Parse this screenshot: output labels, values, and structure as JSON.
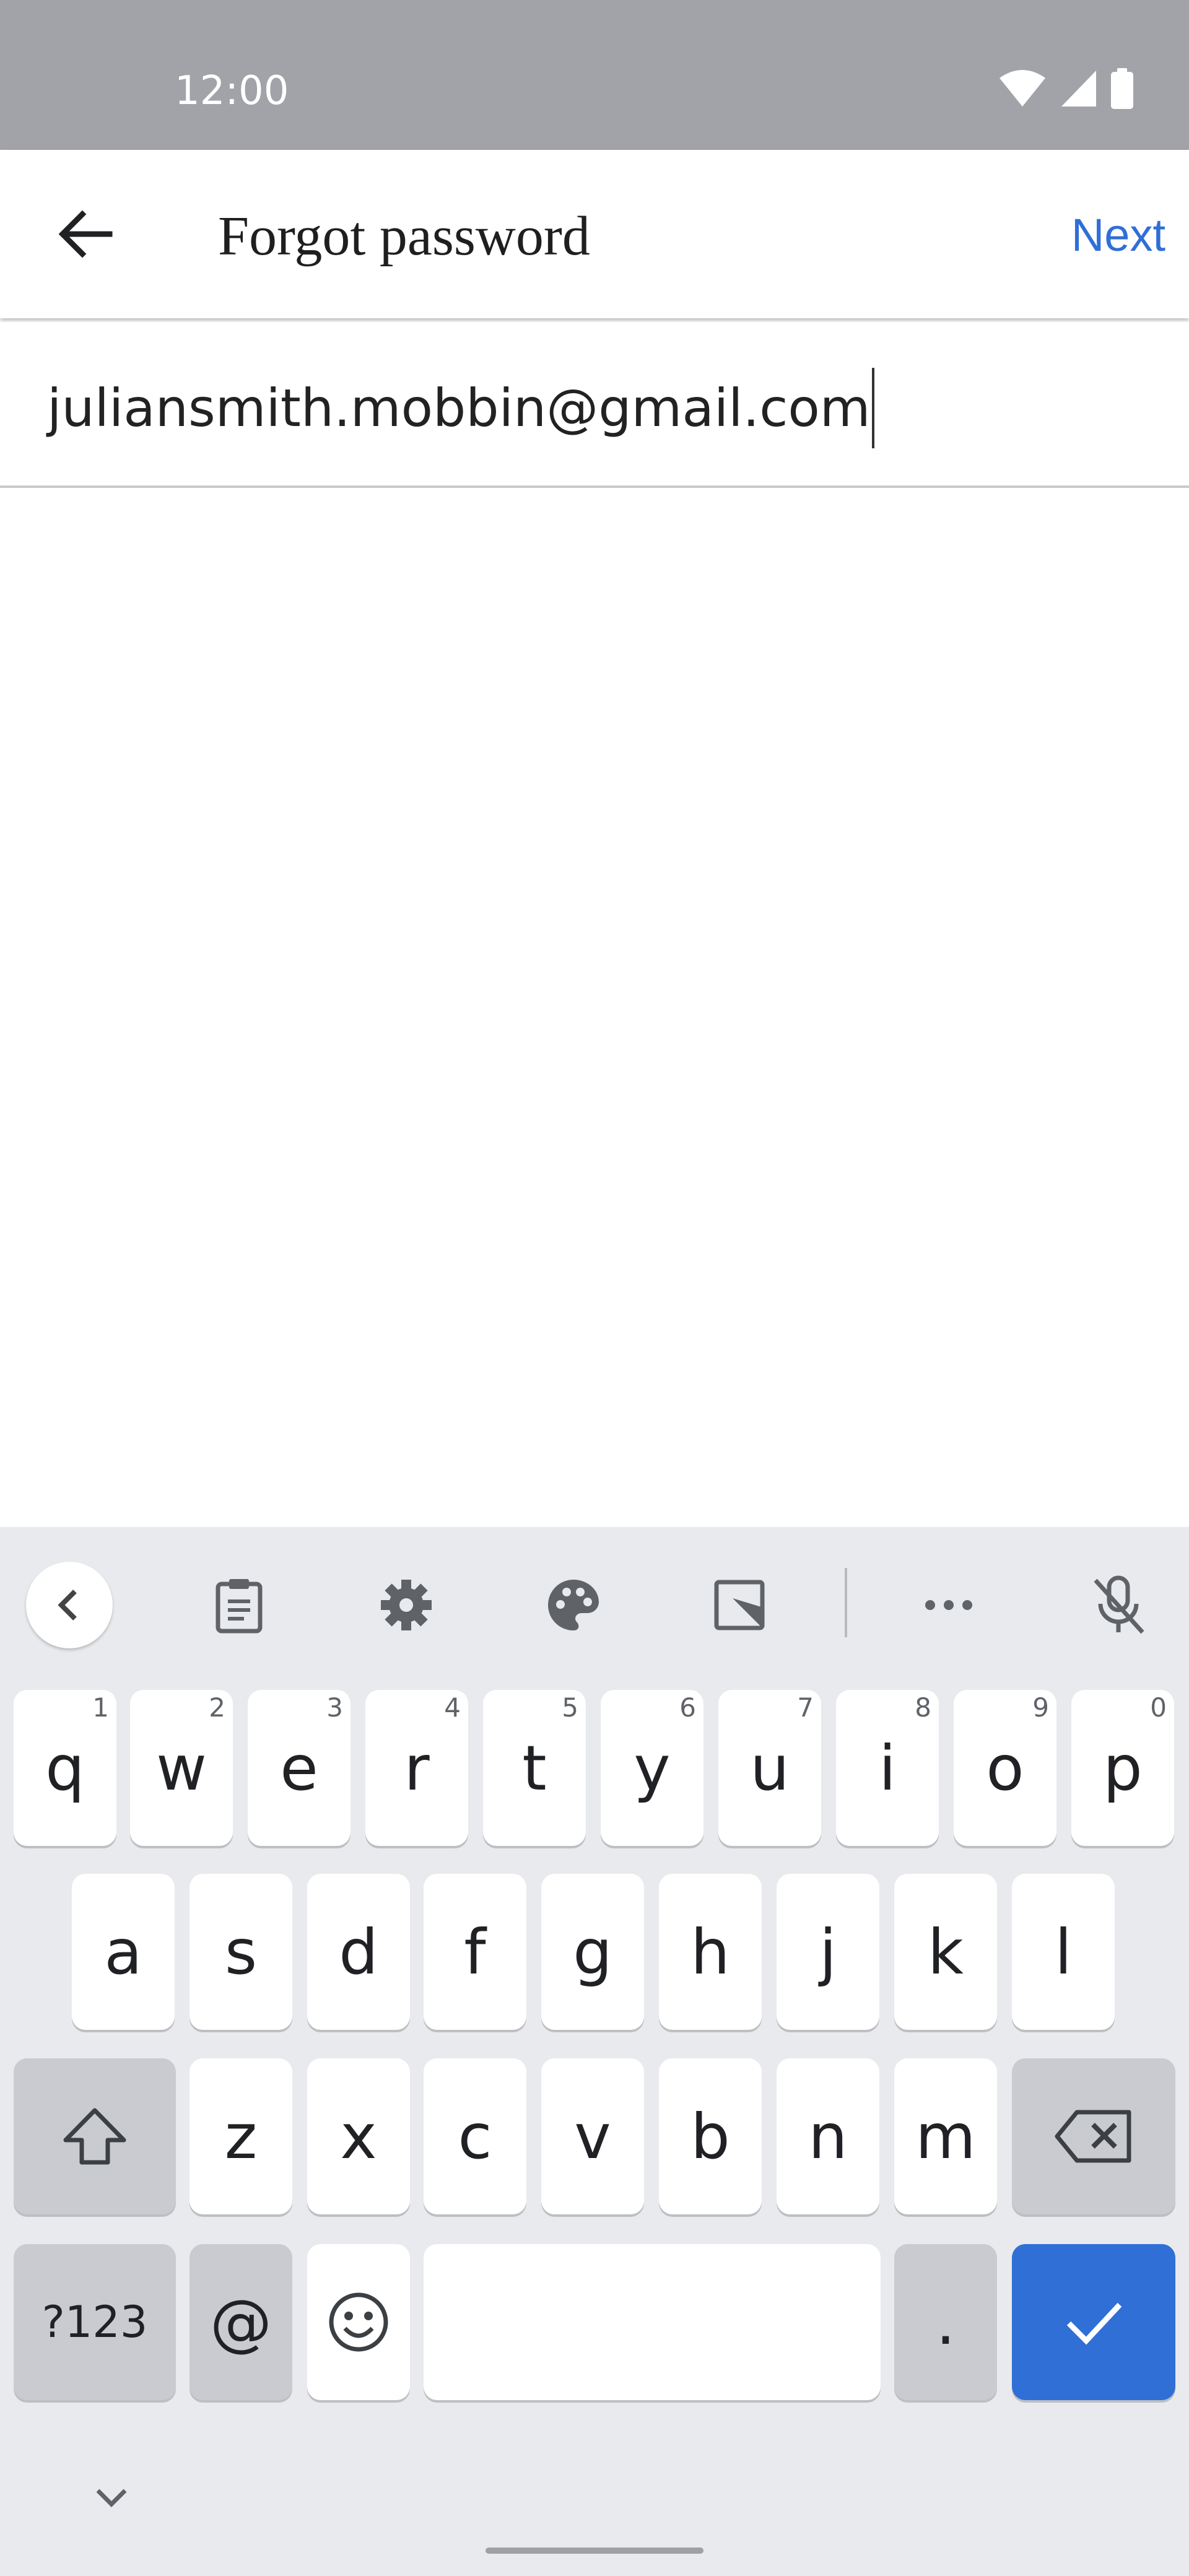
{
  "status_bar": {
    "time": "12:00",
    "icons": [
      "wifi-icon",
      "cellular-signal-icon",
      "battery-icon"
    ]
  },
  "app_bar": {
    "back_icon": "arrow-left-icon",
    "title": "Forgot password",
    "next_label": "Next"
  },
  "email_field": {
    "value": "juliansmith.mobbin@gmail.com"
  },
  "keyboard": {
    "toolbar": [
      "collapse-icon",
      "clipboard-icon",
      "settings-icon",
      "palette-icon",
      "resize-icon",
      "more-icon",
      "mic-off-icon"
    ],
    "row1": [
      {
        "label": "q",
        "hint": "1"
      },
      {
        "label": "w",
        "hint": "2"
      },
      {
        "label": "e",
        "hint": "3"
      },
      {
        "label": "r",
        "hint": "4"
      },
      {
        "label": "t",
        "hint": "5"
      },
      {
        "label": "y",
        "hint": "6"
      },
      {
        "label": "u",
        "hint": "7"
      },
      {
        "label": "i",
        "hint": "8"
      },
      {
        "label": "o",
        "hint": "9"
      },
      {
        "label": "p",
        "hint": "0"
      }
    ],
    "row2": [
      "a",
      "s",
      "d",
      "f",
      "g",
      "h",
      "j",
      "k",
      "l"
    ],
    "row3": [
      "z",
      "x",
      "c",
      "v",
      "b",
      "n",
      "m"
    ],
    "row4": {
      "symbols_label": "?123",
      "at_label": "@",
      "period_label": "."
    }
  },
  "colors": {
    "accent": "#2f6fd6",
    "status_bar": "#a2a3a8",
    "keyboard_bg": "#e8eaed",
    "function_key": "#c9cbd0"
  }
}
